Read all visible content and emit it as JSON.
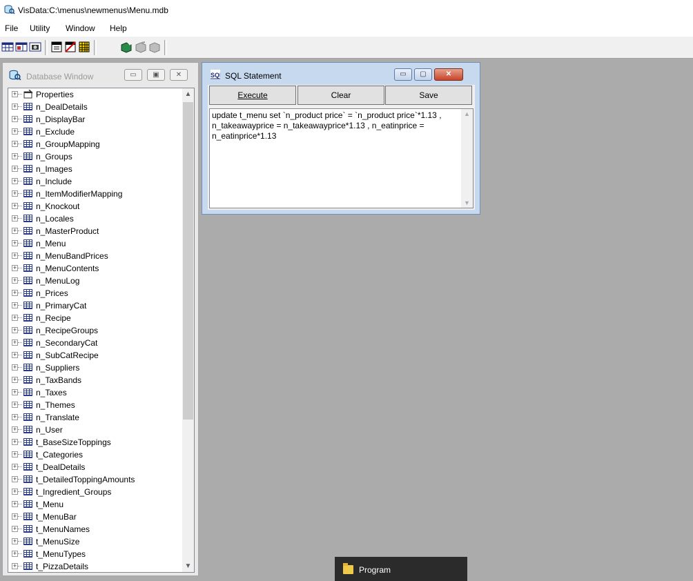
{
  "app": {
    "title": "VisData:C:\\menus\\newmenus\\Menu.mdb"
  },
  "menubar": {
    "items": [
      "File",
      "Utility",
      "Window",
      "Help"
    ]
  },
  "toolbar": {
    "icons": [
      "table-type-icon",
      "dynaset-type-icon",
      "snapshot-type-icon",
      "data-control-icon",
      "no-data-control-icon",
      "dbgrid-icon",
      "begin-transaction-icon",
      "commit-icon",
      "rollback-icon"
    ]
  },
  "database_window": {
    "title": "Database Window",
    "tree_items": [
      "Properties",
      "n_DealDetails",
      "n_DisplayBar",
      "n_Exclude",
      "n_GroupMapping",
      "n_Groups",
      "n_Images",
      "n_Include",
      "n_ItemModifierMapping",
      "n_Knockout",
      "n_Locales",
      "n_MasterProduct",
      "n_Menu",
      "n_MenuBandPrices",
      "n_MenuContents",
      "n_MenuLog",
      "n_Prices",
      "n_PrimaryCat",
      "n_Recipe",
      "n_RecipeGroups",
      "n_SecondaryCat",
      "n_SubCatRecipe",
      "n_Suppliers",
      "n_TaxBands",
      "n_Taxes",
      "n_Themes",
      "n_Translate",
      "n_User",
      "t_BaseSizeToppings",
      "t_Categories",
      "t_DealDetails",
      "t_DetailedToppingAmounts",
      "t_Ingredient_Groups",
      "t_Menu",
      "t_MenuBar",
      "t_MenuNames",
      "t_MenuSize",
      "t_MenuTypes",
      "t_PizzaDetails"
    ]
  },
  "sql_window": {
    "title": "SQL Statement",
    "execute_label": "Execute",
    "clear_label": "Clear",
    "save_label": "Save",
    "statement": "update t_menu set `n_product price` = `n_product price`*1.13 ,\nn_takeawayprice = n_takeawayprice*1.13 , n_eatinprice =\nn_eatinprice*1.13"
  },
  "taskbar_item": {
    "label": "Program"
  }
}
